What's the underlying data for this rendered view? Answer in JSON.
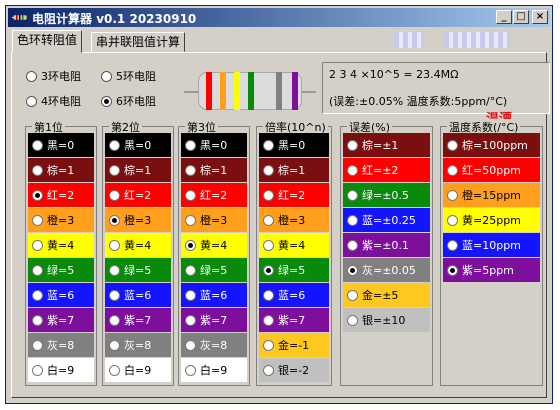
{
  "window": {
    "title": "电阻计算器",
    "version": "v0.1",
    "date": "20230910",
    "buttons": {
      "minimize": "_",
      "maximize": "□",
      "close": "×"
    }
  },
  "tabs": [
    {
      "label": "色环转阻值",
      "active": true
    },
    {
      "label": "串并联阻值计算",
      "active": false
    }
  ],
  "modes": [
    {
      "label": "3环电阻",
      "checked": false
    },
    {
      "label": "5环电阻",
      "checked": false
    },
    {
      "label": "4环电阻",
      "checked": false
    },
    {
      "label": "6环电阻",
      "checked": true
    }
  ],
  "result": {
    "line1": "2 3 4 ×10^5 = 23.4MΩ",
    "line2": "(误差:±0.05% 温度系数:5ppm/°C)"
  },
  "highlight": "温漂",
  "colors": {
    "black": "#000000",
    "brown": "#7b0f0f",
    "red": "#ff0000",
    "orange": "#ff9f1c",
    "yellow": "#ffff00",
    "green": "#0a8a0a",
    "blue": "#1414ff",
    "violet": "#7d0f9c",
    "gray": "#808080",
    "white": "#ffffff",
    "gold": "#ffc81e",
    "silver": "#c0c0c0"
  },
  "selected_bands": [
    "red",
    "orange",
    "yellow",
    "green",
    "gray",
    "violet"
  ],
  "groups": [
    {
      "title": "第1位",
      "selected": 2,
      "items": [
        {
          "label": "黑=0",
          "color": "black"
        },
        {
          "label": "棕=1",
          "color": "brown"
        },
        {
          "label": "红=2",
          "color": "red"
        },
        {
          "label": "橙=3",
          "color": "orange"
        },
        {
          "label": "黄=4",
          "color": "yellow"
        },
        {
          "label": "绿=5",
          "color": "green"
        },
        {
          "label": "蓝=6",
          "color": "blue"
        },
        {
          "label": "紫=7",
          "color": "violet"
        },
        {
          "label": "灰=8",
          "color": "gray"
        },
        {
          "label": "白=9",
          "color": "white"
        }
      ]
    },
    {
      "title": "第2位",
      "selected": 3,
      "items": [
        {
          "label": "黑=0",
          "color": "black"
        },
        {
          "label": "棕=1",
          "color": "brown"
        },
        {
          "label": "红=2",
          "color": "red"
        },
        {
          "label": "橙=3",
          "color": "orange"
        },
        {
          "label": "黄=4",
          "color": "yellow"
        },
        {
          "label": "绿=5",
          "color": "green"
        },
        {
          "label": "蓝=6",
          "color": "blue"
        },
        {
          "label": "紫=7",
          "color": "violet"
        },
        {
          "label": "灰=8",
          "color": "gray"
        },
        {
          "label": "白=9",
          "color": "white"
        }
      ]
    },
    {
      "title": "第3位",
      "selected": 4,
      "items": [
        {
          "label": "黑=0",
          "color": "black"
        },
        {
          "label": "棕=1",
          "color": "brown"
        },
        {
          "label": "红=2",
          "color": "red"
        },
        {
          "label": "橙=3",
          "color": "orange"
        },
        {
          "label": "黄=4",
          "color": "yellow"
        },
        {
          "label": "绿=5",
          "color": "green"
        },
        {
          "label": "蓝=6",
          "color": "blue"
        },
        {
          "label": "紫=7",
          "color": "violet"
        },
        {
          "label": "灰=8",
          "color": "gray"
        },
        {
          "label": "白=9",
          "color": "white"
        }
      ]
    },
    {
      "title": "倍率(10^n)",
      "selected": 5,
      "items": [
        {
          "label": "黑=0",
          "color": "black"
        },
        {
          "label": "棕=1",
          "color": "brown"
        },
        {
          "label": "红=2",
          "color": "red"
        },
        {
          "label": "橙=3",
          "color": "orange"
        },
        {
          "label": "黄=4",
          "color": "yellow"
        },
        {
          "label": "绿=5",
          "color": "green"
        },
        {
          "label": "蓝=6",
          "color": "blue"
        },
        {
          "label": "紫=7",
          "color": "violet"
        },
        {
          "label": "金=-1",
          "color": "gold"
        },
        {
          "label": "银=-2",
          "color": "silver"
        }
      ]
    },
    {
      "title": "误差(%)",
      "selected": 5,
      "items": [
        {
          "label": "棕=±1",
          "color": "brown"
        },
        {
          "label": "红=±2",
          "color": "red"
        },
        {
          "label": "绿=±0.5",
          "color": "green"
        },
        {
          "label": "蓝=±0.25",
          "color": "blue"
        },
        {
          "label": "紫=±0.1",
          "color": "violet"
        },
        {
          "label": "灰=±0.05",
          "color": "gray"
        },
        {
          "label": "金=±5",
          "color": "gold"
        },
        {
          "label": "银=±10",
          "color": "silver"
        }
      ]
    },
    {
      "title": "温度系数(/°C)",
      "selected": 5,
      "items": [
        {
          "label": "棕=100ppm",
          "color": "brown"
        },
        {
          "label": "红=50ppm",
          "color": "red"
        },
        {
          "label": "橙=15ppm",
          "color": "orange"
        },
        {
          "label": "黄=25ppm",
          "color": "yellow"
        },
        {
          "label": "蓝=10ppm",
          "color": "blue"
        },
        {
          "label": "紫=5ppm",
          "color": "violet"
        }
      ]
    }
  ]
}
